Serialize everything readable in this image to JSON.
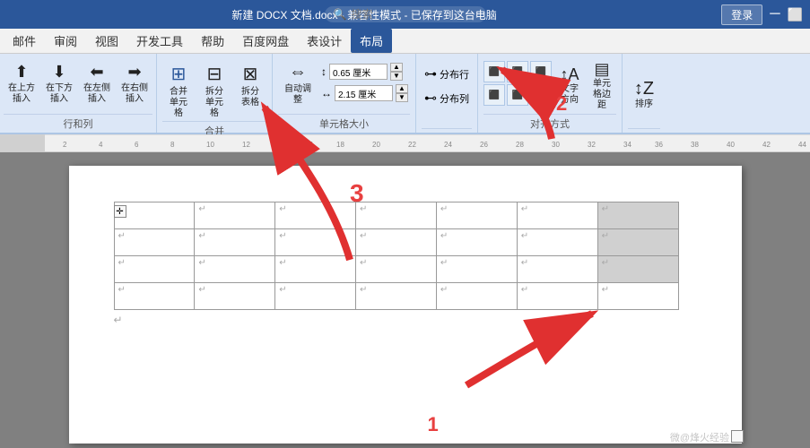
{
  "titlebar": {
    "title": "新建 DOCX 文档.docx - 兼容性模式 - 已保存到这台电脑",
    "login_label": "登录",
    "search_placeholder": "搜索"
  },
  "menu": {
    "items": [
      "邮件",
      "审阅",
      "视图",
      "开发工具",
      "帮助",
      "百度网盘",
      "表设计",
      "布局"
    ]
  },
  "ribbon": {
    "groups": [
      {
        "label": "行和列",
        "buttons": [
          "在上方插入",
          "在下方插入",
          "在左侧插入",
          "在右侧插入"
        ]
      },
      {
        "label": "合并",
        "buttons": [
          "合并单元格",
          "拆分单元格",
          "拆分表格"
        ]
      },
      {
        "label": "单元格大小",
        "height_label": "高度: 0.65 厘米",
        "width_label": "宽度: 2.15 厘米",
        "auto_adjust": "自动调整"
      },
      {
        "label": "",
        "buttons": [
          "分布行",
          "分布列"
        ]
      },
      {
        "label": "对齐方式",
        "buttons": [
          "文字方向",
          "单元格边距",
          "排序"
        ]
      }
    ],
    "num2": "2"
  },
  "table": {
    "rows": 4,
    "cols": 7,
    "shaded_cells": [
      [
        0,
        6
      ],
      [
        1,
        6
      ],
      [
        2,
        6
      ]
    ]
  },
  "labels": {
    "num1": "1",
    "num2": "2",
    "num3": "3"
  },
  "watermark": "微@烽火经验"
}
